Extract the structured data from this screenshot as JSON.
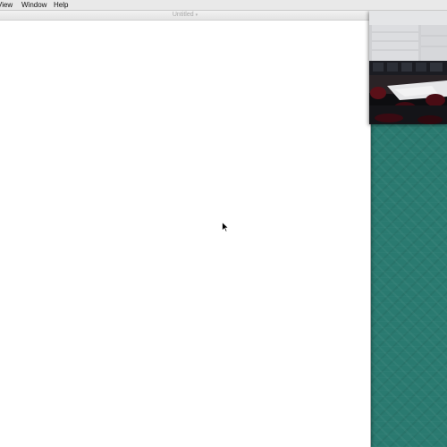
{
  "menubar": {
    "items": [
      {
        "label": "View"
      },
      {
        "label": "Window"
      },
      {
        "label": "Help"
      }
    ]
  },
  "document": {
    "title": "Untitled",
    "title_icon": "chevron-down-icon"
  },
  "camera_overlay": {
    "icon": "webcam-feed"
  },
  "cursor": {
    "icon": "arrow-pointer-icon"
  },
  "colors": {
    "desktop": "#2a7a70",
    "menubar": "#e9e9e9",
    "document": "#ffffff"
  }
}
